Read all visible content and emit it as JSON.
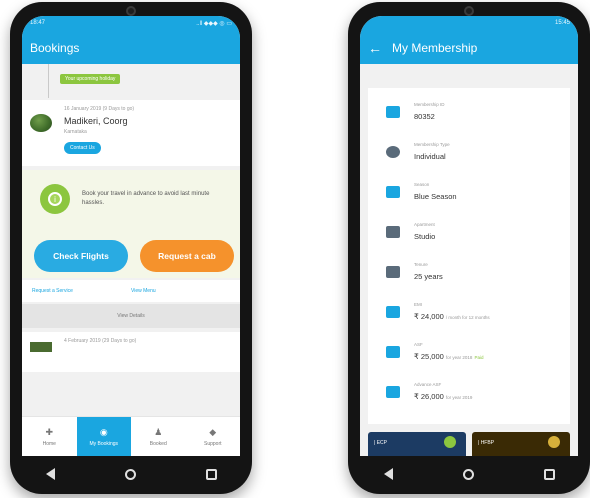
{
  "left": {
    "status_time": "18:47",
    "status_icons": "..ll ◆◆◆ ◎ ▭",
    "title": "Bookings",
    "badge": "Your upcoming holiday",
    "booking1": {
      "date": "16 January 2019 (9 Days to go)",
      "place": "Madikeri, Coorg",
      "region": "Karnataka",
      "contact": "Contact Us"
    },
    "promo_text": "Book your travel in advance to avoid last minute hassles.",
    "check_flights": "Check Flights",
    "request_cab": "Request a cab",
    "request_service": "Request a Service",
    "view_menu": "View Menu",
    "view_details": "View Details",
    "booking2_date": "4 February 2019 (29 Days to go)",
    "tabs": [
      {
        "label": "Home",
        "icon": "home-icon"
      },
      {
        "label": "My Bookings",
        "icon": "bookings-icon"
      },
      {
        "label": "Booked",
        "icon": "user-icon"
      },
      {
        "label": "Support",
        "icon": "support-icon"
      }
    ]
  },
  "right": {
    "status_time": "15:45",
    "title": "My Membership",
    "rows": [
      {
        "label": "Membership ID",
        "value": "80352",
        "icon": "id-card-icon"
      },
      {
        "label": "Membership Type",
        "value": "Individual",
        "icon": "person-icon"
      },
      {
        "label": "Season",
        "value": "Blue Season",
        "icon": "season-icon"
      },
      {
        "label": "Apartment",
        "value": "Studio",
        "icon": "apartment-icon"
      },
      {
        "label": "Tenure",
        "value": "25 years",
        "icon": "calendar-icon"
      },
      {
        "label": "EMI",
        "value": "₹ 24,000",
        "note": "/ month for 12 months",
        "icon": "emi-icon"
      },
      {
        "label": "ASF",
        "value": "₹ 25,000",
        "note": "for year 2018",
        "paid": "Paid",
        "icon": "asf-icon"
      },
      {
        "label": "Advance ASF",
        "value": "₹ 26,000",
        "note": "for year 2019",
        "icon": "advance-asf-icon"
      }
    ],
    "card_ecp": "| ECP",
    "card_hfbp": "| HFBP"
  },
  "colors": {
    "primary": "#1aa6e0",
    "green": "#8cc63f",
    "orange": "#f5922c"
  }
}
